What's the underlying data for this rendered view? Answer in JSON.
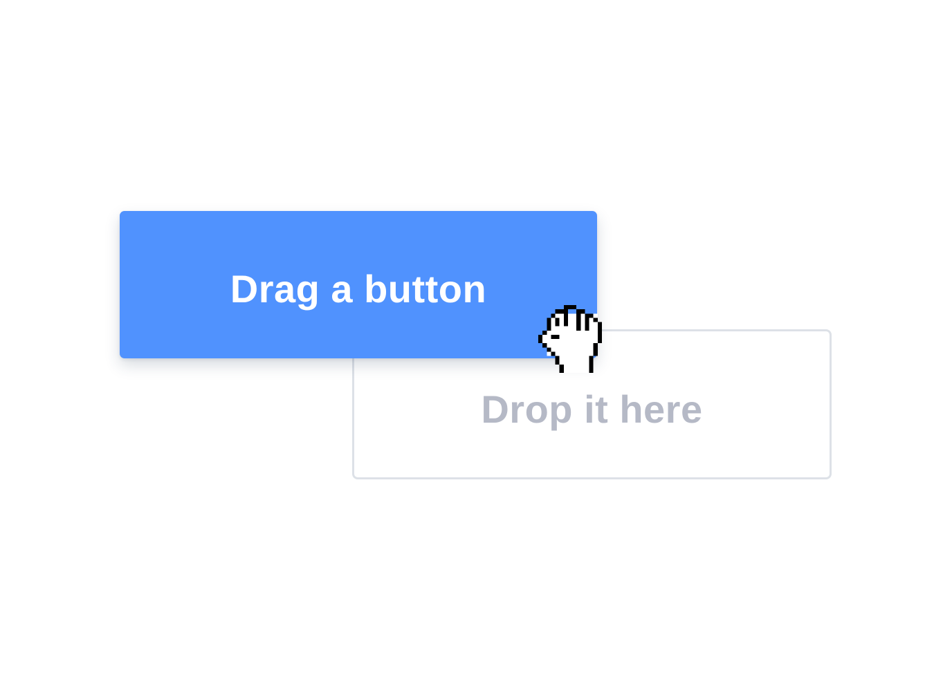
{
  "drag_button": {
    "label": "Drag a button",
    "color": "#5092fe"
  },
  "drop_zone": {
    "label": "Drop it here",
    "border_color": "#dde1e7",
    "text_color": "#b5b9c6"
  },
  "cursor": {
    "icon": "grab-hand-cursor-icon"
  }
}
